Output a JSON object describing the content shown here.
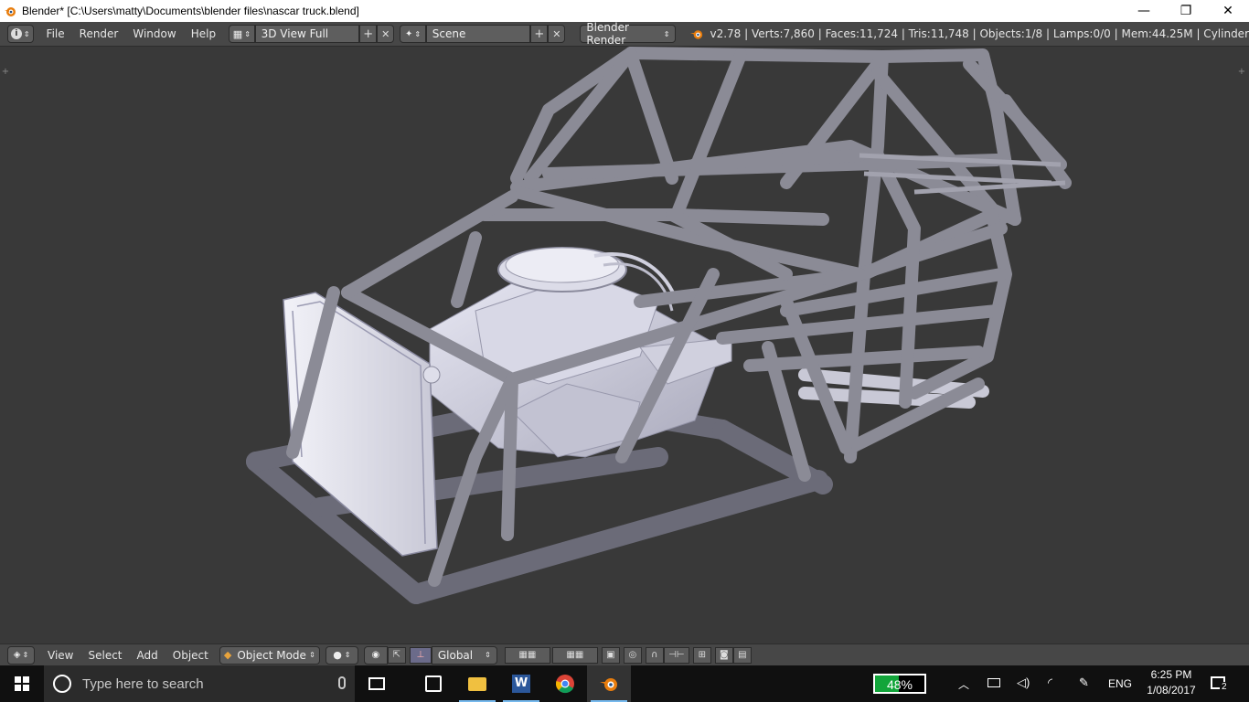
{
  "window": {
    "title": "Blender* [C:\\Users\\matty\\Documents\\blender files\\nascar truck.blend]",
    "min_glyph": "—",
    "restore_glyph": "❐",
    "close_glyph": "✕"
  },
  "infobar": {
    "menus": [
      "File",
      "Render",
      "Window",
      "Help"
    ],
    "screen_layout": "3D View Full",
    "scene": "Scene",
    "render_engine": "Blender Render",
    "stats": "v2.78 | Verts:7,860 | Faces:11,724 | Tris:11,748 | Objects:1/8 | Lamps:0/0 | Mem:44.25M | Cylinder"
  },
  "viewheader": {
    "menus": [
      "View",
      "Select",
      "Add",
      "Object"
    ],
    "mode": "Object Mode",
    "orientation": "Global"
  },
  "taskbar": {
    "search_placeholder": "Type here to search",
    "battery": "48%",
    "language": "ENG",
    "time": "6:25 PM",
    "date": "1/08/2017",
    "notifications": "2"
  },
  "colors": {
    "viewport_bg": "#393939",
    "header_bg": "#474747",
    "tube": "#8e8e98",
    "accent_blender": "#e87d0d",
    "battery_fill": "#12a53a"
  }
}
